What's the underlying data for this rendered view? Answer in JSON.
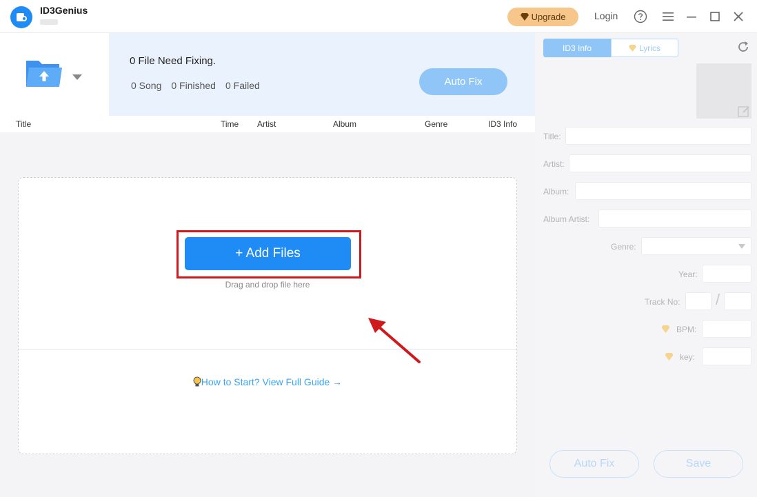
{
  "app": {
    "name": "ID3Genius"
  },
  "titlebar": {
    "upgrade_label": "Upgrade",
    "login_label": "Login",
    "help_icon": "question-circle-icon",
    "menu_icon": "hamburger-menu-icon",
    "minimize_icon": "minimize-icon",
    "maximize_icon": "maximize-icon",
    "close_icon": "close-icon"
  },
  "status": {
    "title": "0 File Need Fixing.",
    "song": "0 Song",
    "finished": "0 Finished",
    "failed": "0 Failed",
    "autofix_label": "Auto Fix"
  },
  "table": {
    "columns": [
      "Title",
      "Time",
      "Artist",
      "Album",
      "Genre",
      "ID3 Info"
    ]
  },
  "dropzone": {
    "add_files_label": "+ Add Files",
    "hint": "Drag and drop file here",
    "guide_label": "How to Start? View Full Guide →"
  },
  "right": {
    "tabs": [
      "ID3 Info",
      "Lyrics"
    ],
    "fields": {
      "title": "Title:",
      "artist": "Artist:",
      "album": "Album:",
      "album_artist": "Album Artist:",
      "genre": "Genre:",
      "year": "Year:",
      "track_no": "Track No:",
      "track_sep": "/",
      "bpm": "BPM:",
      "key": "key:"
    },
    "autofix_label": "Auto Fix",
    "save_label": "Save"
  },
  "colors": {
    "accent": "#1f8cf6",
    "highlight_red": "#d0191c",
    "upgrade_bg": "#f6c68a"
  }
}
